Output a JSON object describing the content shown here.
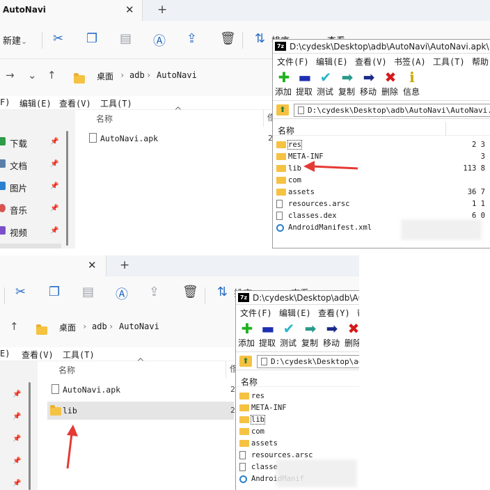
{
  "explorer": {
    "tab_title": "AutoNavi",
    "close_glyph": "✕",
    "plus_glyph": "+",
    "new_label": "新建",
    "new_chevron": "⌄",
    "sort_label": "排序",
    "view_label": "查看",
    "nav_back": "→",
    "nav_down": "⌄",
    "nav_up": "↑",
    "breadcrumb": [
      "桌面",
      "adb",
      "AutoNavi"
    ],
    "breadcrumb_sep": "›",
    "menu": [
      "F)",
      "编辑(E)",
      "查看(V)",
      "工具(T)"
    ],
    "menu_short": [
      "E)",
      "查看(V)",
      "工具(T)"
    ],
    "sidebar": [
      {
        "label": "下载",
        "color": "#2e9c4a"
      },
      {
        "label": "文档",
        "color": "#5b7fa8"
      },
      {
        "label": "图片",
        "color": "#2a7fcf"
      },
      {
        "label": "音乐",
        "color": "#d9534f"
      },
      {
        "label": "视频",
        "color": "#7b4fc9"
      }
    ],
    "pin_glyph": "📌",
    "col_name": "名称",
    "col_size_partial": "俢",
    "sort_caret": "^",
    "files_top": [
      {
        "name": "AutoNavi.apk"
      }
    ],
    "files_bottom": [
      {
        "name": "AutoNavi.apk"
      },
      {
        "name": "lib"
      }
    ],
    "size_partial": "2"
  },
  "sevenzip": {
    "logo": "7z",
    "title": "D:\\cydesk\\Desktop\\adb\\AutoNavi\\AutoNavi.apk\\",
    "title_short": "D:\\cydesk\\Desktop\\adb\\Auto",
    "menu": [
      "文件(F)",
      "编辑(E)",
      "查看(V)",
      "书签(A)",
      "工具(T)",
      "帮助"
    ],
    "menu_short": [
      "文件(F)",
      "编辑(E)",
      "查看(Y)",
      "帮"
    ],
    "tools": [
      {
        "label": "添加",
        "glyph": "✚",
        "color": "#1fb21f"
      },
      {
        "label": "提取",
        "glyph": "▬",
        "color": "#1f2fb2"
      },
      {
        "label": "测试",
        "glyph": "✔",
        "color": "#2bb5c8"
      },
      {
        "label": "复制",
        "glyph": "➡",
        "color": "#2a9a8a"
      },
      {
        "label": "移动",
        "glyph": "➡",
        "color": "#1a2a8a"
      },
      {
        "label": "删除",
        "glyph": "✖",
        "color": "#d41a1a"
      },
      {
        "label": "信息",
        "glyph": "ℹ",
        "color": "#c8a800"
      }
    ],
    "up_glyph": "⬆",
    "path": "D:\\cydesk\\Desktop\\adb\\AutoNavi\\AutoNavi.ap",
    "path_short": "D:\\cydesk\\Desktop\\adb",
    "col_name": "名称",
    "rows_top": [
      {
        "name": "res",
        "type": "folder",
        "size": "2 3"
      },
      {
        "name": "META-INF",
        "type": "folder",
        "size": "3"
      },
      {
        "name": "lib",
        "type": "folder",
        "size": "113 8"
      },
      {
        "name": "com",
        "type": "folder",
        "size": ""
      },
      {
        "name": "assets",
        "type": "folder",
        "size": "36 7"
      },
      {
        "name": "resources.arsc",
        "type": "file",
        "size": "1 1"
      },
      {
        "name": "classes.dex",
        "type": "file",
        "size": "6 0"
      },
      {
        "name": "AndroidManifest.xml",
        "type": "manifest",
        "size": ""
      }
    ],
    "rows_bottom": [
      {
        "name": "res",
        "type": "folder"
      },
      {
        "name": "META-INF",
        "type": "folder"
      },
      {
        "name": "lib",
        "type": "folder"
      },
      {
        "name": "com",
        "type": "folder"
      },
      {
        "name": "assets",
        "type": "folder"
      },
      {
        "name": "resources.arsc",
        "type": "file"
      },
      {
        "name": "classe",
        "type": "file"
      },
      {
        "name": "AndroidManif",
        "type": "manifest"
      }
    ]
  },
  "colors": {
    "arrow": "#e53935",
    "selected_row": "#e5e5e5"
  }
}
